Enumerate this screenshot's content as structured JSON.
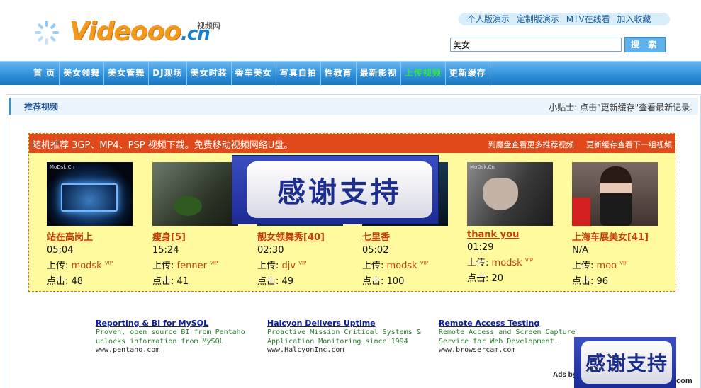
{
  "logo": {
    "text": "Videooo",
    "suffix": ".cn",
    "cn": "视频网"
  },
  "toplinks": [
    "个人版演示",
    "定制版演示",
    "MTV在线看",
    "加入收藏"
  ],
  "search": {
    "value": "美女",
    "button": "搜 索"
  },
  "nav": [
    {
      "label": "首 页"
    },
    {
      "label": "美女领舞"
    },
    {
      "label": "美女管舞"
    },
    {
      "label": "DJ现场"
    },
    {
      "label": "美女时装"
    },
    {
      "label": "香车美女"
    },
    {
      "label": "写真自拍"
    },
    {
      "label": "性教育"
    },
    {
      "label": "最新影视"
    },
    {
      "label": "上传视频",
      "highlight": true
    },
    {
      "label": "更新缓存"
    }
  ],
  "panel": {
    "title": "推荐视频",
    "tip": "小贴士: 点击\"更新缓存\"查看最新记录."
  },
  "recommend": {
    "bar_text": "随机推荐 3GP、MP4、PSP 视频下载。免费移动视频网络U盘。",
    "link1": "到魔盘查看更多推荐视频",
    "link2": "更新缓存查看下一组视频"
  },
  "videos": [
    {
      "title": "站在高岗上",
      "duration": "05:04",
      "uploader_label": "上传:",
      "uploader": "modsk",
      "vip": "VIP",
      "clicks_label": "点击:",
      "clicks": "48",
      "watermark": "MoDsk.Cn"
    },
    {
      "title": "瘦身[5]",
      "duration": "15:24",
      "uploader_label": "上传:",
      "uploader": "fenner",
      "vip": "VIP",
      "clicks_label": "点击:",
      "clicks": "41",
      "watermark": ""
    },
    {
      "title": "靓女领舞秀[40]",
      "duration": "02:30",
      "uploader_label": "上传:",
      "uploader": "djv",
      "vip": "VIP",
      "clicks_label": "点击:",
      "clicks": "49",
      "watermark": ""
    },
    {
      "title": "七里香",
      "duration": "05:02",
      "uploader_label": "上传:",
      "uploader": "modsk",
      "vip": "VIP",
      "clicks_label": "点击:",
      "clicks": "100",
      "watermark": ""
    },
    {
      "title": "thank  you",
      "duration": "01:29",
      "uploader_label": "上传:",
      "uploader": "modsk",
      "vip": "VIP",
      "clicks_label": "点击:",
      "clicks": "20",
      "watermark": "MoDsk.Cn"
    },
    {
      "title": "上海车展美女[41]",
      "duration": "N/A",
      "uploader_label": "上传:",
      "uploader": "moo",
      "vip": "VIP",
      "clicks_label": "点击:",
      "clicks": "96",
      "watermark": ""
    }
  ],
  "overlay": {
    "text": "感谢支持"
  },
  "ads": [
    {
      "title": "Reporting & BI for MySQL",
      "desc": [
        "Proven, open source BI from Pentaho",
        "unlocks information from MySQL"
      ],
      "url": "www.pentaho.com"
    },
    {
      "title": "Halcyon Delivers Uptime",
      "desc": [
        "Proactive Mission Critical Systems &",
        "Application Monitoring since 1994"
      ],
      "url": "www.HalcyonInc.com"
    },
    {
      "title": "Remote Access Testing",
      "desc": [
        "Remote Access and Screen Capture",
        "Service for Web Development."
      ],
      "url": "www.browsercam.com"
    }
  ],
  "ads_by": "Ads by",
  "ads_com": "com",
  "colors": {
    "nav": "#2d8ed8",
    "highlight": "#2fe54b",
    "link": "#c2410b",
    "bar": "#e2491a",
    "box": "#fffa9d"
  }
}
